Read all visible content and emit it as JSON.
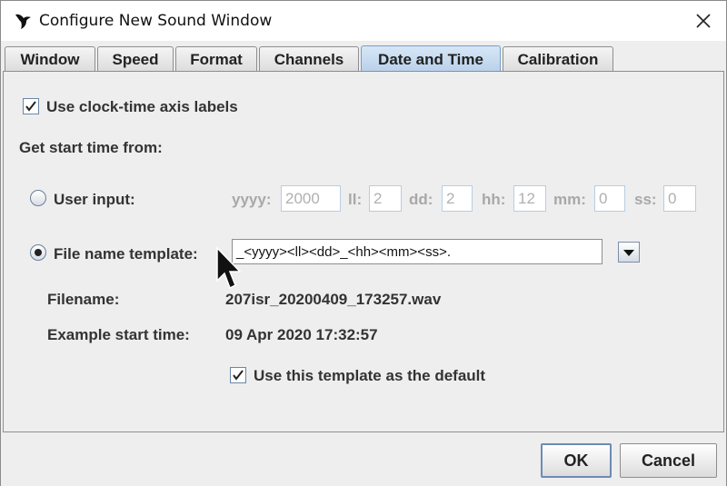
{
  "window": {
    "title": "Configure New Sound Window"
  },
  "tabs": [
    {
      "label": "Window",
      "active": false
    },
    {
      "label": "Speed",
      "active": false
    },
    {
      "label": "Format",
      "active": false
    },
    {
      "label": "Channels",
      "active": false
    },
    {
      "label": "Date and Time",
      "active": true
    },
    {
      "label": "Calibration",
      "active": false
    }
  ],
  "date_time": {
    "use_clock_time_label": "Use clock-time axis labels",
    "use_clock_time_checked": true,
    "start_time_heading": "Get start time from:",
    "user_input": {
      "label": "User input:",
      "selected": false,
      "fields": [
        {
          "label": "yyyy:",
          "value": "2000"
        },
        {
          "label": "ll:",
          "value": "2"
        },
        {
          "label": "dd:",
          "value": "2"
        },
        {
          "label": "hh:",
          "value": "12"
        },
        {
          "label": "mm:",
          "value": "0"
        },
        {
          "label": "ss:",
          "value": "0"
        }
      ]
    },
    "file_name_template": {
      "label": "File name template:",
      "selected": true,
      "value": "_<yyyy><ll><dd>_<hh><mm><ss>."
    },
    "filename_label": "Filename:",
    "filename_value": "207isr_20200409_173257.wav",
    "example_label": "Example start time:",
    "example_value": "09 Apr 2020 17:32:57",
    "default_template_label": "Use this template as the default",
    "default_template_checked": true
  },
  "buttons": {
    "ok": "OK",
    "cancel": "Cancel"
  },
  "icons": {
    "app": "bird-icon",
    "close": "close-icon",
    "dropdown": "triangle-down-icon",
    "check": "checkmark-icon",
    "cursor": "mouse-pointer-icon"
  },
  "colors": {
    "active_tab": "#b8d0ea",
    "disabled_text": "#a8a8a8",
    "default_button_border": "#6d8bb3"
  }
}
